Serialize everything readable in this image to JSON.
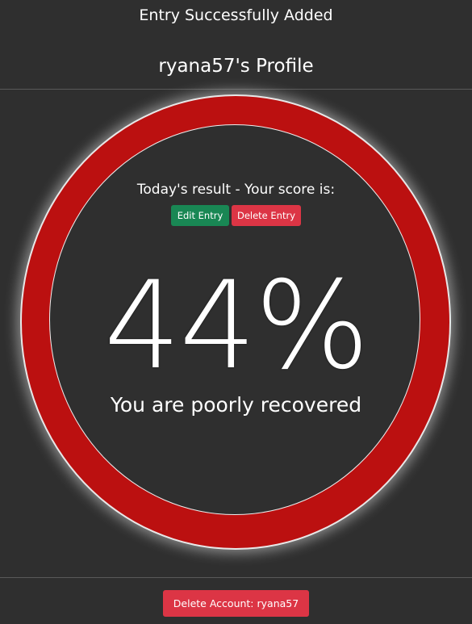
{
  "flash": {
    "message": "Entry Successfully Added"
  },
  "profile": {
    "title": "ryana57's Profile"
  },
  "result": {
    "label": "Today's result - Your score is:",
    "edit_label": "Edit Entry",
    "delete_label": "Delete Entry",
    "score": "44%",
    "status": "You are poorly recovered",
    "ring_color": "#bb1010"
  },
  "footer": {
    "delete_account_label": "Delete Account: ryana57"
  },
  "colors": {
    "background": "#2f2f2f",
    "edit_button": "#198754",
    "delete_button": "#dc3545"
  }
}
